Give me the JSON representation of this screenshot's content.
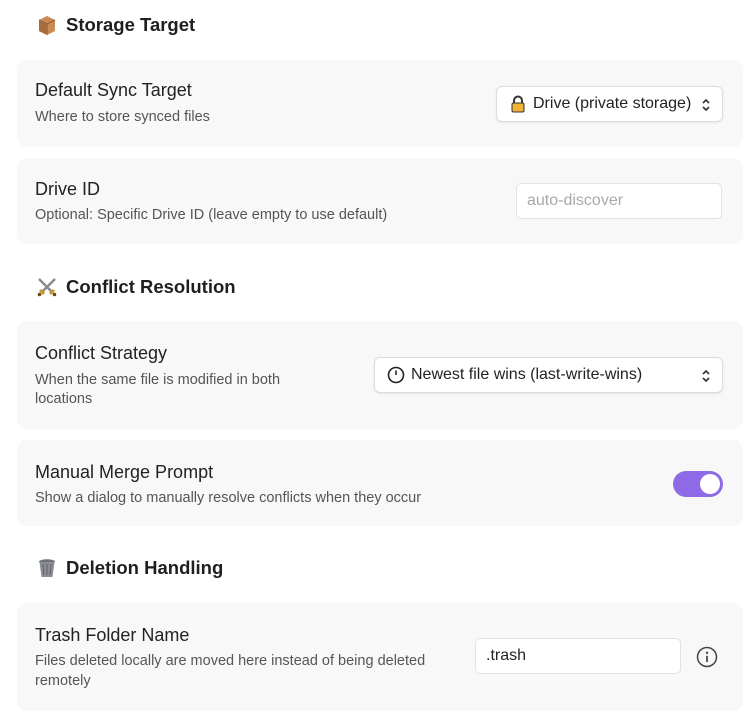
{
  "sections": {
    "storage": {
      "title": "Storage Target",
      "icon": "package-box-icon"
    },
    "conflict": {
      "title": "Conflict Resolution",
      "icon": "crossed-swords-icon"
    },
    "deletion": {
      "title": "Deletion Handling",
      "icon": "wastebasket-icon"
    }
  },
  "settings": {
    "default_sync_target": {
      "label": "Default Sync Target",
      "description": "Where to store synced files",
      "selected": "Drive (private storage)",
      "selected_icon": "lock-icon"
    },
    "drive_id": {
      "label": "Drive ID",
      "description": "Optional: Specific Drive ID (leave empty to use default)",
      "value": "",
      "placeholder": "auto-discover"
    },
    "conflict_strategy": {
      "label": "Conflict Strategy",
      "description_line1": "When the same file is modified in both",
      "description_line2": "locations",
      "selected": "Newest file wins (last-write-wins)",
      "selected_icon": "clock-icon"
    },
    "manual_merge_prompt": {
      "label": "Manual Merge Prompt",
      "description": "Show a dialog to manually resolve conflicts when they occur",
      "enabled": true
    },
    "trash_folder_name": {
      "label": "Trash Folder Name",
      "description_line1": "Files deleted locally are moved here instead of being deleted",
      "description_line2": "remotely",
      "value": ".trash"
    }
  },
  "colors": {
    "toggle_on": "#8f6ae6",
    "card_bg": "#f8f8f8"
  }
}
